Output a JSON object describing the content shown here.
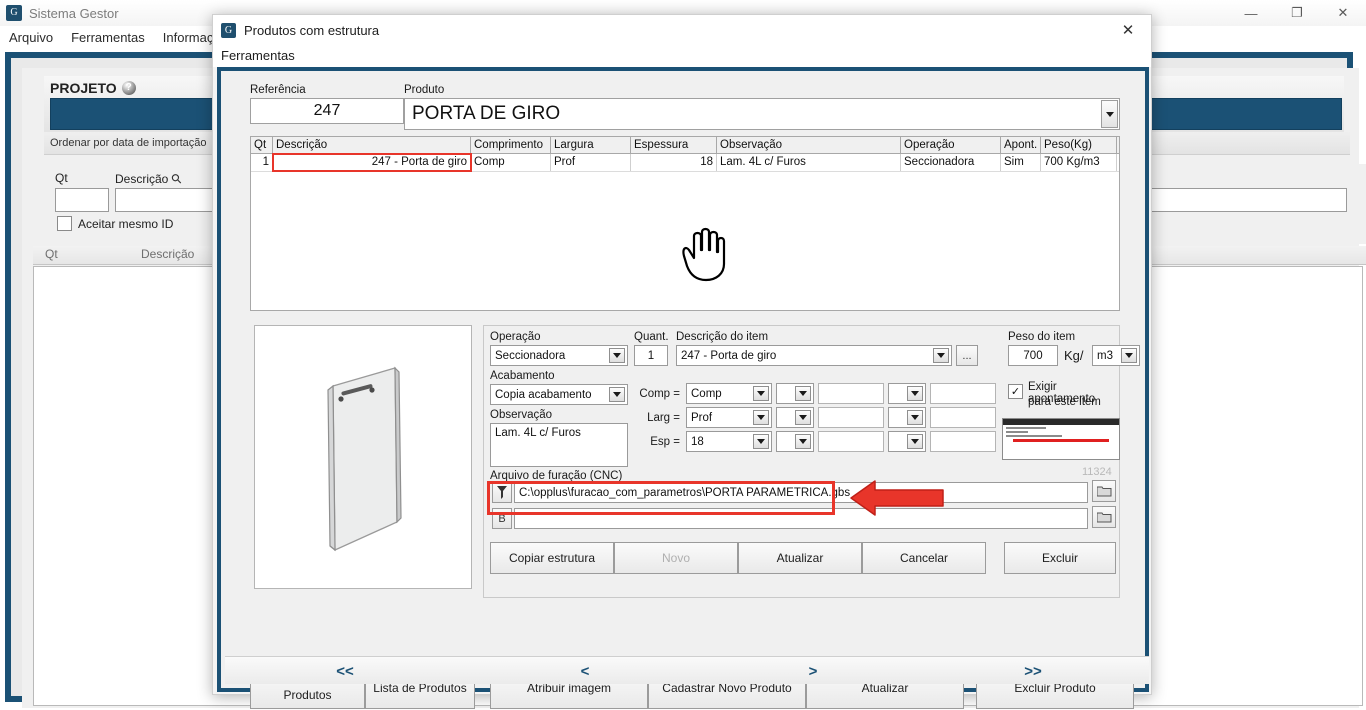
{
  "background_window": {
    "title": "Sistema Gestor",
    "app_icon": "G",
    "menu": [
      "Arquivo",
      "Ferramentas",
      "Informações"
    ],
    "window_controls": {
      "minimize": "—",
      "maximize": "❐",
      "close": "✕"
    },
    "panel": {
      "projeto_label": "PROJETO",
      "help_icon": "?",
      "projeto_value": "",
      "ordenar_text": "Ordenar por data de importação",
      "filter_qt_label": "Qt",
      "filter_desc_label": "Descrição",
      "search_icon": "search-icon",
      "filter_qt_value": "",
      "filter_desc_value": "",
      "checkbox_label": "Aceitar mesmo ID",
      "checkbox_checked": false,
      "grid_headers": [
        "Qt",
        "Descrição"
      ]
    }
  },
  "dialog": {
    "title": "Produtos com estrutura",
    "app_icon": "G",
    "close_label": "✕",
    "menu": [
      "Ferramentas"
    ],
    "referencia": {
      "label": "Referência",
      "value": "247"
    },
    "produto": {
      "label": "Produto",
      "value": "PORTA DE GIRO"
    },
    "table": {
      "headers": [
        "Qt",
        "Descrição",
        "Comprimento",
        "Largura",
        "Espessura",
        "Observação",
        "Operação",
        "Apont.",
        "Peso(Kg)"
      ],
      "rows": [
        {
          "qt": "1",
          "descricao": "247 - Porta de giro",
          "comprimento": "Comp",
          "largura": "Prof",
          "espessura": "18",
          "observacao": "Lam. 4L c/ Furos",
          "operacao": "Seccionadora",
          "apont": "Sim",
          "peso": "700 Kg/m3"
        }
      ]
    },
    "detail": {
      "operacao_label": "Operação",
      "operacao_value": "Seccionadora",
      "quant_label": "Quant.",
      "quant_value": "1",
      "descricao_item_label": "Descrição do item",
      "descricao_item_value": "247 - Porta de giro",
      "ellipsis_button": "...",
      "acabamento_label": "Acabamento",
      "acabamento_value": "Copia acabamento",
      "observacao_label": "Observação",
      "observacao_value": "Lam. 4L c/ Furos",
      "dim_rows": [
        {
          "label": "Comp =",
          "value": "Comp",
          "extra1": "",
          "extra2": "",
          "extra3": "",
          "extra4": ""
        },
        {
          "label": "Larg =",
          "value": "Prof",
          "extra1": "",
          "extra2": "",
          "extra3": "",
          "extra4": ""
        },
        {
          "label": "Esp =",
          "value": "18",
          "extra1": "",
          "extra2": "",
          "extra3": "",
          "extra4": ""
        }
      ],
      "peso_item_label": "Peso do item",
      "peso_item_value": "700",
      "peso_unit_prefix": "Kg/",
      "peso_unit_value": "m3",
      "exigir_label_line1": "Exigir apontamento",
      "exigir_label_line2": "para este item",
      "exigir_checked": true,
      "thumb_code": "11324",
      "cnc_label": "Arquivo de furação (CNC)",
      "cnc_path_1": "C:\\opplus\\furacao_com_parametros\\PORTA PARAMETRICA.gbs",
      "cnc_path_2": "",
      "cnc_icon_1": "drill-icon",
      "cnc_icon_2": "B",
      "browse_icon": "folder-icon",
      "buttons": [
        {
          "label": "Copiar estrutura",
          "enabled": true
        },
        {
          "label": "Novo",
          "enabled": false
        },
        {
          "label": "Atualizar",
          "enabled": true
        },
        {
          "label": "Cancelar",
          "enabled": true
        },
        {
          "label": "Excluir",
          "enabled": true
        }
      ]
    },
    "footer_buttons": [
      {
        "label": "Relatório de Produtos"
      },
      {
        "label": "Lista de Produtos"
      },
      {
        "label": "Atribuir imagem"
      },
      {
        "label": "Cadastrar Novo Produto"
      },
      {
        "label": "Atualizar"
      },
      {
        "label": "Excluir Produto"
      }
    ],
    "nav_buttons": [
      "<<",
      "<",
      ">",
      ">>"
    ]
  },
  "colors": {
    "accent_dark_blue": "#1b5175",
    "highlight_red": "#e8352a",
    "dialog_bg": "#f0f0f0"
  }
}
